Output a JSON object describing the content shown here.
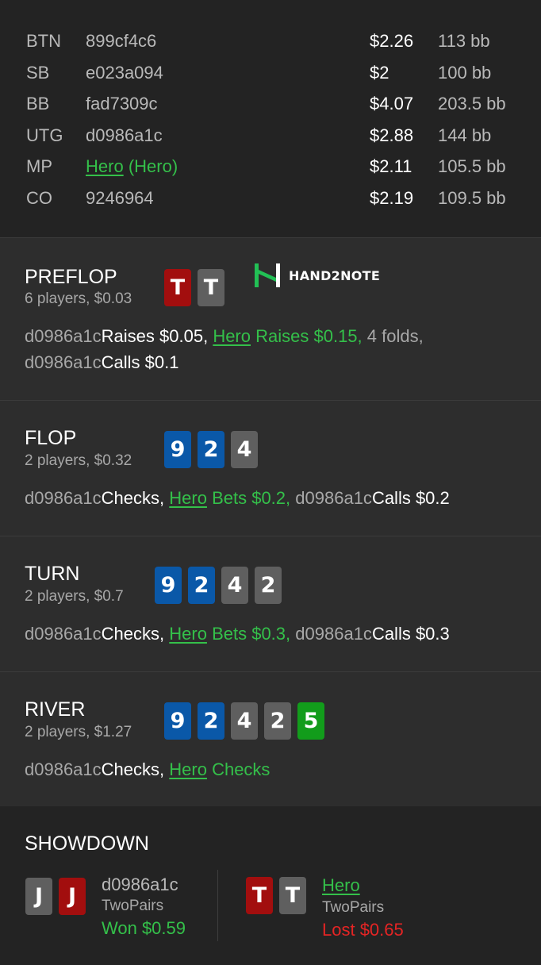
{
  "seats": [
    {
      "pos": "BTN",
      "name": "899cf4c6",
      "stack": "$2.26",
      "bb": "113 bb"
    },
    {
      "pos": "SB",
      "name": "e023a094",
      "stack": "$2",
      "bb": "100 bb"
    },
    {
      "pos": "BB",
      "name": "fad7309c",
      "stack": "$4.07",
      "bb": "203.5 bb"
    },
    {
      "pos": "UTG",
      "name": "d0986a1c",
      "stack": "$2.88",
      "bb": "144 bb"
    },
    {
      "pos": "MP",
      "name": "Hero",
      "name_suffix": "(Hero)",
      "stack": "$2.11",
      "bb": "105.5 bb"
    },
    {
      "pos": "CO",
      "name": "9246964",
      "stack": "$2.19",
      "bb": "109.5 bb"
    }
  ],
  "logo": {
    "text": "HAND2NOTE"
  },
  "preflop": {
    "title": "PREFLOP",
    "sub": "6 players, $0.03",
    "cards": [
      {
        "rank": "T",
        "color": "#a20e0e"
      },
      {
        "rank": "T",
        "color": "#5f5f5f"
      }
    ],
    "line1": {
      "p1": "d0986a1c",
      "a1": "Raises $0.05,",
      "hero": "Hero",
      "hero_act": "Raises $0.15,",
      "folds": "4 folds,"
    },
    "line2": {
      "p1": "d0986a1c",
      "a1": "Calls $0.1"
    }
  },
  "flop": {
    "title": "FLOP",
    "sub": "2 players, $0.32",
    "cards": [
      {
        "rank": "9",
        "color": "#0a58a8"
      },
      {
        "rank": "2",
        "color": "#0a58a8"
      },
      {
        "rank": "4",
        "color": "#5f5f5f"
      }
    ],
    "p1": "d0986a1c",
    "a1": "Checks,",
    "hero": "Hero",
    "hero_act": "Bets $0.2,",
    "p2": "d0986a1c",
    "a2": "Calls $0.2"
  },
  "turn": {
    "title": "TURN",
    "sub": "2 players, $0.7",
    "cards": [
      {
        "rank": "9",
        "color": "#0a58a8"
      },
      {
        "rank": "2",
        "color": "#0a58a8"
      },
      {
        "rank": "4",
        "color": "#5f5f5f"
      },
      {
        "rank": "2",
        "color": "#5f5f5f"
      }
    ],
    "p1": "d0986a1c",
    "a1": "Checks,",
    "hero": "Hero",
    "hero_act": "Bets $0.3,",
    "p2": "d0986a1c",
    "a2": "Calls $0.3"
  },
  "river": {
    "title": "RIVER",
    "sub": "2 players, $1.27",
    "cards": [
      {
        "rank": "9",
        "color": "#0a58a8"
      },
      {
        "rank": "2",
        "color": "#0a58a8"
      },
      {
        "rank": "4",
        "color": "#5f5f5f"
      },
      {
        "rank": "2",
        "color": "#5f5f5f"
      },
      {
        "rank": "5",
        "color": "#129c1b"
      }
    ],
    "p1": "d0986a1c",
    "a1": "Checks,",
    "hero": "Hero",
    "hero_act": "Checks"
  },
  "showdown": {
    "title": "SHOWDOWN",
    "villain": {
      "cards": [
        {
          "rank": "J",
          "color": "#5f5f5f"
        },
        {
          "rank": "J",
          "color": "#a20e0e"
        }
      ],
      "name": "d0986a1c",
      "hand": "TwoPairs",
      "result": "Won $0.59"
    },
    "hero": {
      "cards": [
        {
          "rank": "T",
          "color": "#a20e0e"
        },
        {
          "rank": "T",
          "color": "#5f5f5f"
        }
      ],
      "name": "Hero",
      "hand": "TwoPairs",
      "result": "Lost $0.65"
    }
  }
}
